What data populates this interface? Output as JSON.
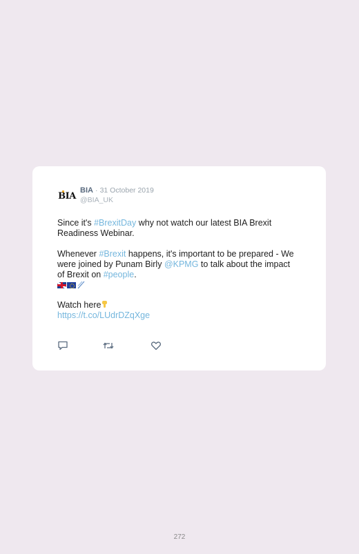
{
  "tweet": {
    "avatar_text": "BIA",
    "author_name": "BIA",
    "separator": "·",
    "date": "31 October 2019",
    "handle": "@BIA_UK",
    "line1_a": "Since it's ",
    "line1_hashtag": "#BrexitDay",
    "line1_b": " why not watch our latest BIA Brexit Readiness Webinar.",
    "line2_a": "Whenever ",
    "line2_hashtag": "#Brexit",
    "line2_b": " happens, it's important to be prepared - We were joined by Punam Birly ",
    "line2_mention": "@KPMG",
    "line2_c": " to talk about the impact of Brexit on ",
    "line2_hashtag2": "#people",
    "line2_end": ".",
    "watch_text": "Watch here",
    "link_url": "https://t.co/LUdrDZqXge",
    "emojis": [
      "uk-flag-icon",
      "eu-flag-icon",
      "dna-icon",
      "pointing-down-icon"
    ]
  },
  "actions": {
    "reply": "reply-icon",
    "retweet": "retweet-icon",
    "like": "like-icon"
  },
  "page_number": "272",
  "colors": {
    "background": "#efe8ef",
    "card": "#ffffff",
    "link": "#74b6dd",
    "name": "#5a6b7f"
  }
}
